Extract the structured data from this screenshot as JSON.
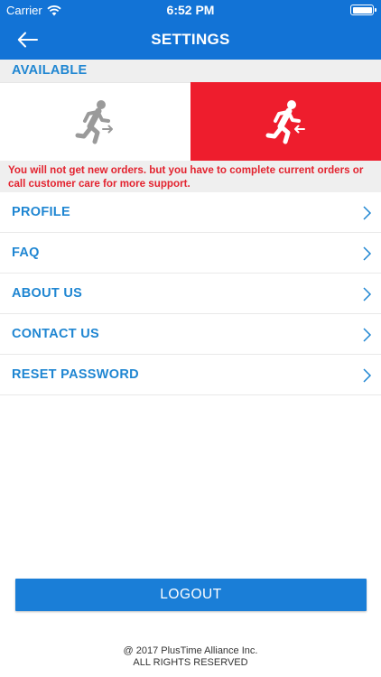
{
  "status_bar": {
    "carrier": "Carrier",
    "time": "6:52 PM"
  },
  "header": {
    "title": "SETTINGS",
    "back_icon": "arrow-left-icon",
    "background": "#1273d6"
  },
  "availability": {
    "label": "AVAILABLE",
    "options": [
      {
        "icon": "running-man-icon",
        "selected": false
      },
      {
        "icon": "running-man-icon",
        "selected": true,
        "color": "#ee1d2d"
      }
    ],
    "message": "You will not get new orders. but you have to complete current orders or call customer care for more support."
  },
  "menu": {
    "items": [
      {
        "label": "PROFILE"
      },
      {
        "label": "FAQ"
      },
      {
        "label": "ABOUT US"
      },
      {
        "label": "CONTACT US"
      },
      {
        "label": "RESET PASSWORD"
      }
    ]
  },
  "logout": {
    "label": "LOGOUT"
  },
  "footer": {
    "line1": "@ 2017 PlusTime Alliance Inc.",
    "line2": "ALL RIGHTS RESERVED"
  },
  "colors": {
    "accent": "#1f86d2",
    "danger": "#e3232f",
    "button": "#1a7ed7"
  }
}
